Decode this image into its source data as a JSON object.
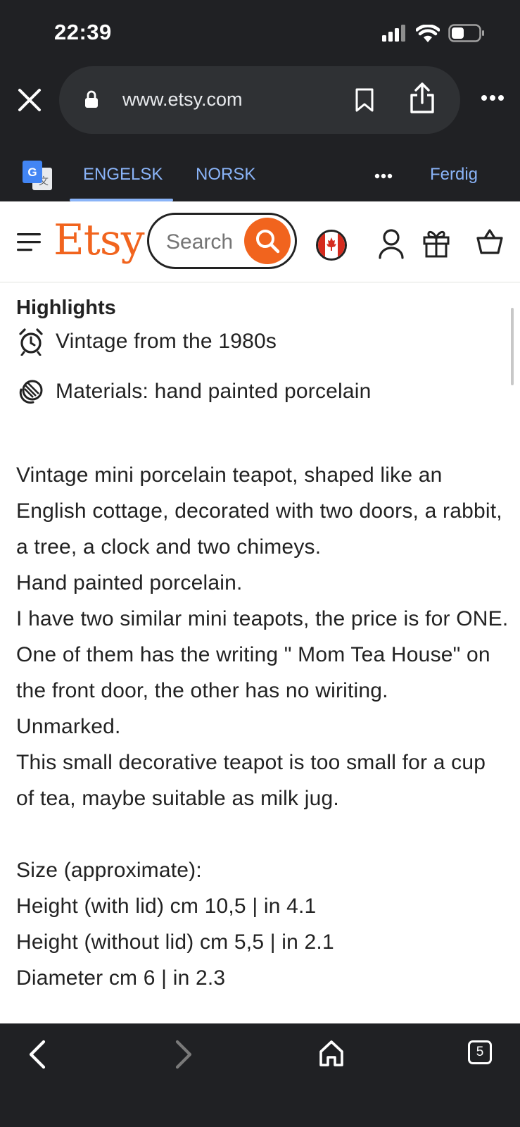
{
  "status_bar": {
    "time": "22:39"
  },
  "browser": {
    "url": "www.etsy.com",
    "tab_count": "5"
  },
  "translate_bar": {
    "lang_source": "ENGELSK",
    "lang_target": "NORSK",
    "done": "Ferdig",
    "active_tab": "ENGELSK"
  },
  "etsy_header": {
    "logo": "Etsy",
    "search_placeholder": "Search"
  },
  "highlights": {
    "title": "Highlights",
    "items": [
      {
        "icon": "alarm-clock-icon",
        "text": "Vintage from the 1980s"
      },
      {
        "icon": "materials-icon",
        "text": "Materials: hand painted porcelain"
      }
    ]
  },
  "description": {
    "lines": [
      "Vintage mini porcelain teapot, shaped like an English cottage, decorated with two doors, a rabbit, a tree, a clock and two chimeys.",
      "Hand painted porcelain.",
      "I have two similar mini teapots, the price is for ONE.",
      "One of them has the writing \" Mom Tea House\" on the front door, the other has no wiriting.",
      "Unmarked.",
      "This small decorative teapot is too small for a cup of tea, maybe suitable as milk jug.",
      "",
      "Size (approximate):",
      "Height (with lid) cm 10,5 | in 4.1",
      "Height (without lid) cm 5,5 | in 2.1",
      "Diameter cm 6 | in 2.3"
    ]
  },
  "colors": {
    "etsy_orange": "#f1641e",
    "browser_dark": "#202124",
    "link_blue": "#8ab4f8"
  }
}
